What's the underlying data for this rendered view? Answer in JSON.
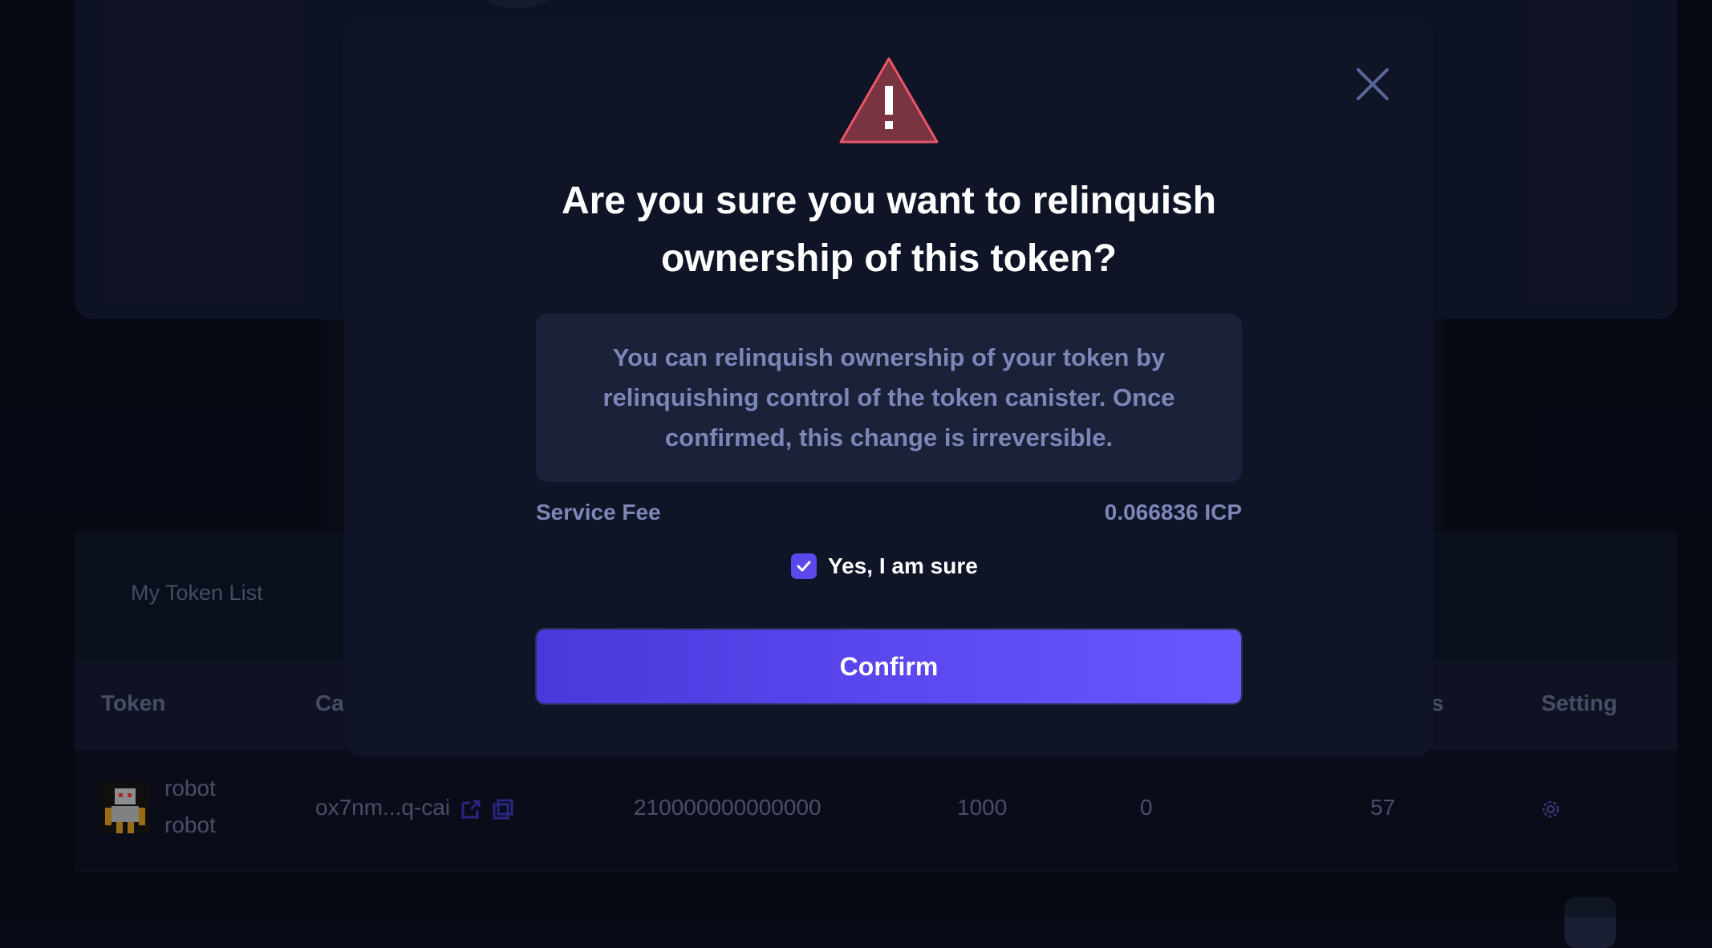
{
  "background": {
    "token_list_tab": "My Token List",
    "table_headers": [
      "Token",
      "Ca",
      "rs",
      "Setting"
    ],
    "row": {
      "token_name": "robot",
      "token_symbol": "robot",
      "canister": "ox7nm...q-cai",
      "total_supply": "210000000000000",
      "decimals_or_fee": "1000",
      "col5": "0",
      "holders": "57"
    }
  },
  "modal": {
    "title": "Are you sure you want to relinquish ownership of this token?",
    "info": "You can relinquish ownership of your token by relinquishing control of the token canister. Once confirmed, this change is irreversible.",
    "fee_label": "Service Fee",
    "fee_value": "0.066836 ICP",
    "checkbox_label": "Yes, I am sure",
    "checkbox_checked": true,
    "confirm_label": "Confirm",
    "icons": [
      "warning-triangle-icon",
      "close-icon",
      "check-icon"
    ],
    "colors": {
      "accent": "#5b48ea",
      "warning": "#7a3441",
      "modal_bg": "#0f1427",
      "info_bg": "#1b2139",
      "muted_text": "#7d86b7"
    }
  }
}
